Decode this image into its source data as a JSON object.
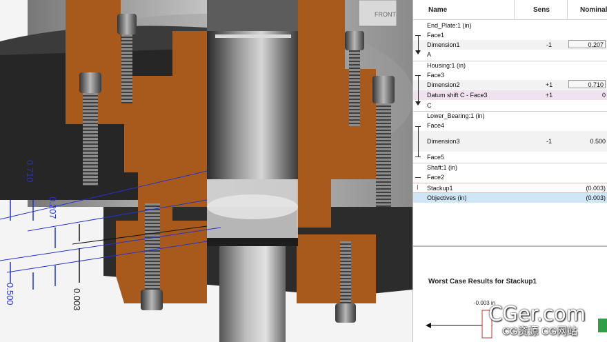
{
  "viewport": {
    "view_cube_label": "FRONT",
    "dims": [
      {
        "text": "0.710",
        "color": "#2233cc"
      },
      {
        "text": "0.207",
        "color": "#2233cc"
      },
      {
        "text": "0.003",
        "color": "#111111"
      },
      {
        "text": "0.500",
        "color": "#2233cc"
      }
    ]
  },
  "table": {
    "headers": {
      "name": "Name",
      "sens": "Sens",
      "nominal": "Nominal"
    },
    "groups": [
      {
        "part": "End_Plate:1 (in)",
        "face_a": "Face1",
        "dim": "Dimension1",
        "sens": "-1",
        "nominal": "0.207",
        "face_b": "A"
      },
      {
        "part": "Housing:1 (in)",
        "face_a": "Face3",
        "dim": "Dimension2",
        "sens": "+1",
        "nominal": "0.710",
        "extra": "Datum shift C - Face3",
        "extra_sens": "+1",
        "extra_nominal": "0",
        "face_b": "C"
      },
      {
        "part": "Lower_Bearing:1 (in)",
        "face_a": "Face4",
        "dim": "Dimension3",
        "sens": "-1",
        "nominal": "0.500",
        "face_b": "Face5"
      },
      {
        "part": "Shaft:1 (in)",
        "face_a": "Face2"
      }
    ],
    "stackup": {
      "label": "Stackup1",
      "nominal": "(0.003)"
    },
    "objectives": {
      "label": "Objectives (in)",
      "nominal": "(0.003)"
    }
  },
  "results": {
    "title": "Worst Case Results for Stackup1",
    "value": "-0.003 in"
  },
  "watermark": {
    "big": "CGer.com",
    "small": "CG资源 CG网站"
  },
  "colors": {
    "copper": "#a85a1d",
    "blue_dim": "#2233cc",
    "selection": "#cfe6f6",
    "datum": "#f1e2ef"
  }
}
